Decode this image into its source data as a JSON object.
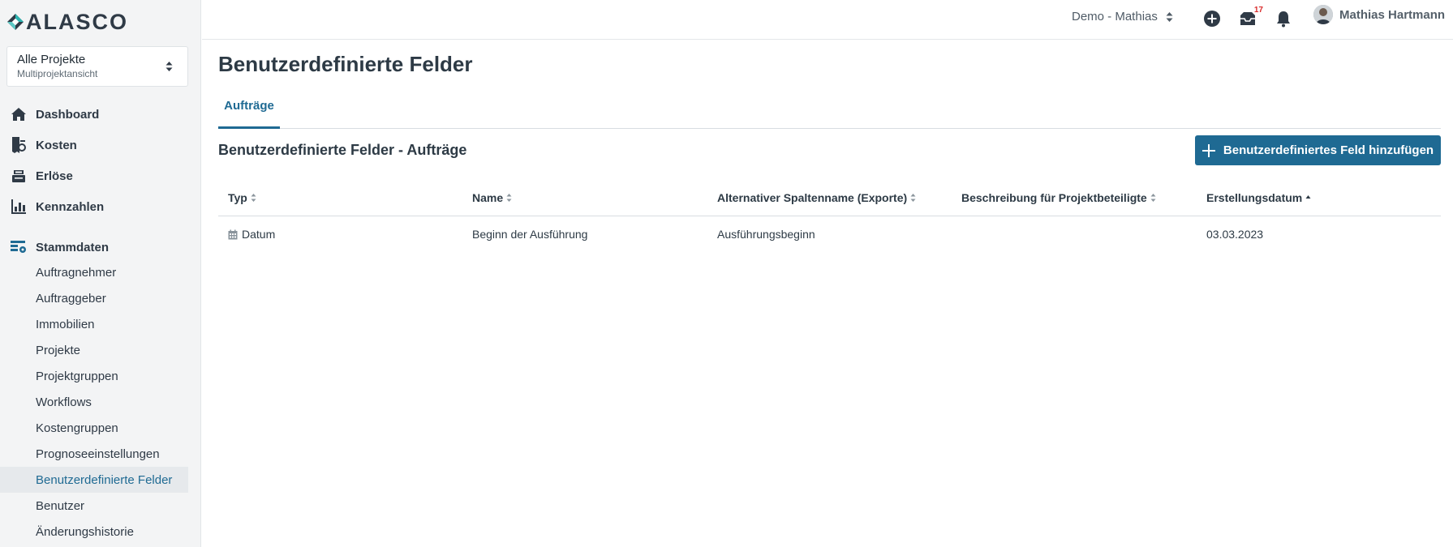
{
  "app": {
    "logo_text": "ALASCO",
    "brand_color": "#1f6a93",
    "accent_logo_color": "#2bb3b0"
  },
  "sidebar": {
    "project_selector": {
      "title": "Alle Projekte",
      "subtitle": "Multiprojektansicht"
    },
    "main_items": [
      {
        "label": "Dashboard",
        "icon": "home-icon"
      },
      {
        "label": "Kosten",
        "icon": "invoice-icon"
      },
      {
        "label": "Erlöse",
        "icon": "cash-register-icon"
      },
      {
        "label": "Kennzahlen",
        "icon": "chart-icon"
      }
    ],
    "stammdaten": {
      "label": "Stammdaten",
      "icon": "database-settings-icon"
    },
    "sub_items": [
      {
        "label": "Auftragnehmer"
      },
      {
        "label": "Auftraggeber"
      },
      {
        "label": "Immobilien"
      },
      {
        "label": "Projekte"
      },
      {
        "label": "Projektgruppen"
      },
      {
        "label": "Workflows"
      },
      {
        "label": "Kostengruppen"
      },
      {
        "label": "Prognoseeinstellungen"
      },
      {
        "label": "Benutzerdefinierte Felder",
        "active": true
      },
      {
        "label": "Benutzer"
      },
      {
        "label": "Änderungshistorie"
      }
    ]
  },
  "topbar": {
    "org_selector": "Demo - Mathias",
    "inbox_badge": "17",
    "user_name": "Mathias Hartmann"
  },
  "page": {
    "title": "Benutzerdefinierte Felder",
    "tabs": [
      {
        "label": "Aufträge",
        "active": true
      }
    ],
    "section_title": "Benutzerdefinierte Felder - Aufträge",
    "add_button": "Benutzerdefiniertes Feld hinzufügen"
  },
  "table": {
    "columns": [
      {
        "label": "Typ",
        "sort": "none"
      },
      {
        "label": "Name",
        "sort": "none"
      },
      {
        "label": "Alternativer Spaltenname (Exporte)",
        "sort": "none"
      },
      {
        "label": "Beschreibung für Projektbeteiligte",
        "sort": "none"
      },
      {
        "label": "Erstellungsdatum",
        "sort": "asc"
      }
    ],
    "rows": [
      {
        "typ": "Datum",
        "typ_icon": "calendar-icon",
        "name": "Beginn der Ausführung",
        "alt_name": "Ausführungsbeginn",
        "beschreibung": "",
        "erstellungsdatum": "03.03.2023"
      }
    ]
  }
}
